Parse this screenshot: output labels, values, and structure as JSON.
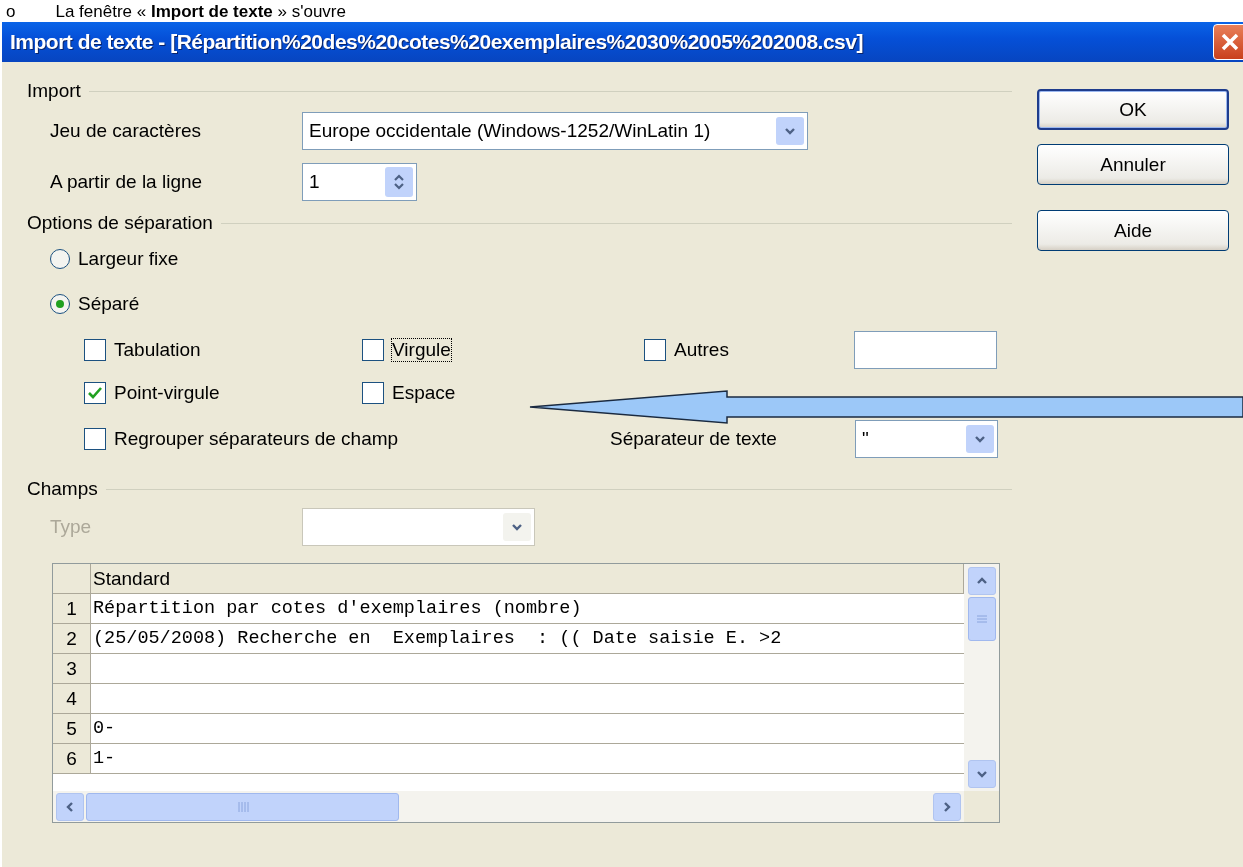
{
  "caption": {
    "bullet": "o",
    "text": "La fenêtre « **Import de texte** » s'ouvre"
  },
  "window": {
    "title": "Import de texte - [Répartition%20des%20cotes%20exemplaires%2030%2005%202008.csv]"
  },
  "import": {
    "label": "Import",
    "charset": {
      "label": "Jeu de caractères",
      "value": "Europe occidentale (Windows-1252/WinLatin 1)"
    },
    "from_line": {
      "label": "A partir de la ligne",
      "value": "1"
    }
  },
  "separation": {
    "label": "Options de séparation",
    "modes": [
      {
        "label": "Largeur fixe",
        "selected": false
      },
      {
        "label": "Séparé",
        "selected": true
      }
    ],
    "separators": [
      {
        "label": "Tabulation",
        "checked": false,
        "focused": false
      },
      {
        "label": "Virgule",
        "checked": false,
        "focused": true
      },
      {
        "label": "Autres",
        "checked": false,
        "focused": false
      },
      {
        "label": "Point-virgule",
        "checked": true,
        "focused": false
      },
      {
        "label": "Espace",
        "checked": false,
        "focused": false
      }
    ],
    "merge": {
      "label": "Regrouper séparateurs de champ",
      "checked": false
    },
    "text_separator": {
      "label": "Séparateur de texte",
      "value": "\""
    }
  },
  "fields": {
    "label": "Champs",
    "type": {
      "label": "Type",
      "disabled": true
    },
    "table": {
      "column": "Standard",
      "rows": [
        {
          "number": "1",
          "text": "Répartition par cotes d'exemplaires (nombre)"
        },
        {
          "number": "2",
          "text": "(25/05/2008) Recherche en  Exemplaires  : (( Date saisie E. >2"
        },
        {
          "number": "3",
          "text": ""
        },
        {
          "number": "4",
          "text": ""
        },
        {
          "number": "5",
          "text": "0-"
        },
        {
          "number": "6",
          "text": "1-"
        }
      ]
    }
  },
  "buttons": [
    {
      "label": "OK",
      "default": true
    },
    {
      "label": "Annuler",
      "default": false
    },
    {
      "label": "Aide",
      "default": false
    }
  ]
}
